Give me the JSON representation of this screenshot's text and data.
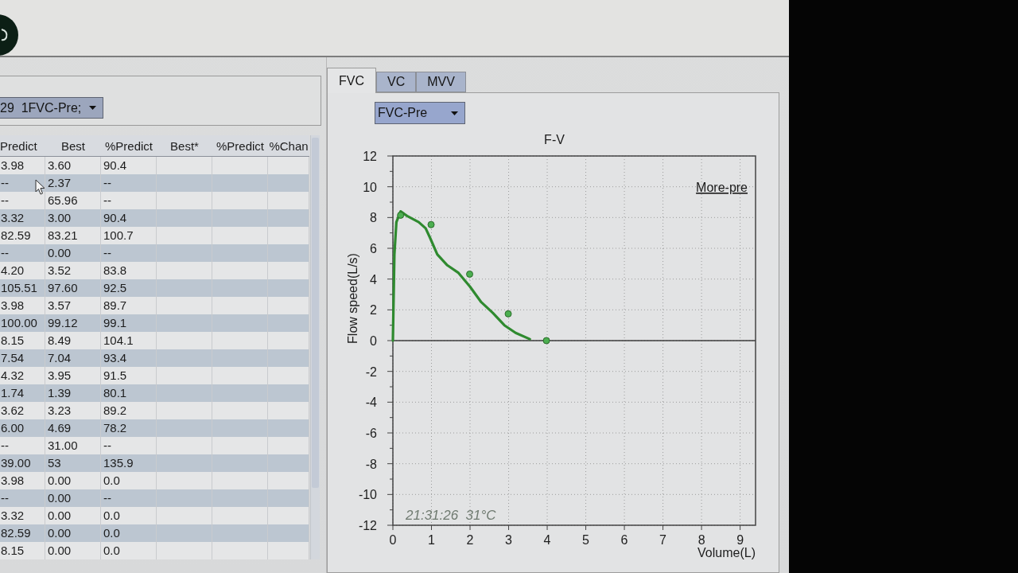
{
  "test_selector": {
    "value": "29  1FVC-Pre;"
  },
  "results_table": {
    "columns": [
      "Predict",
      "Best",
      "%Predict",
      "Best*",
      "%Predict",
      "%Chan"
    ],
    "rows": [
      [
        "3.98",
        "3.60",
        "90.4"
      ],
      [
        "--",
        "2.37",
        "--"
      ],
      [
        "--",
        "65.96",
        "--"
      ],
      [
        "3.32",
        "3.00",
        "90.4"
      ],
      [
        "82.59",
        "83.21",
        "100.7"
      ],
      [
        "--",
        "0.00",
        "--"
      ],
      [
        "4.20",
        "3.52",
        "83.8"
      ],
      [
        "105.51",
        "97.60",
        "92.5"
      ],
      [
        "3.98",
        "3.57",
        "89.7"
      ],
      [
        "100.00",
        "99.12",
        "99.1"
      ],
      [
        "8.15",
        "8.49",
        "104.1"
      ],
      [
        "7.54",
        "7.04",
        "93.4"
      ],
      [
        "4.32",
        "3.95",
        "91.5"
      ],
      [
        "1.74",
        "1.39",
        "80.1"
      ],
      [
        "3.62",
        "3.23",
        "89.2"
      ],
      [
        "6.00",
        "4.69",
        "78.2"
      ],
      [
        "--",
        "31.00",
        "--"
      ],
      [
        "39.00",
        "53",
        "135.9"
      ],
      [
        "3.98",
        "0.00",
        "0.0"
      ],
      [
        "--",
        "0.00",
        "--"
      ],
      [
        "3.32",
        "0.00",
        "0.0"
      ],
      [
        "82.59",
        "0.00",
        "0.0"
      ],
      [
        "8.15",
        "0.00",
        "0.0"
      ]
    ]
  },
  "chart_panel": {
    "tabs": [
      {
        "label": "FVC",
        "selected": true
      },
      {
        "label": "VC",
        "selected": false
      },
      {
        "label": "MVV",
        "selected": false
      }
    ],
    "curve_selector": {
      "value": "FVC-Pre"
    },
    "chart_data": [
      {
        "type": "line",
        "title": "F-V",
        "xlabel": "Volume(L)",
        "ylabel": "Flow speed(L/s)",
        "xlim": [
          0,
          9.4
        ],
        "ylim": [
          -12,
          12
        ],
        "xticks": [
          0,
          1,
          2,
          3,
          4,
          5,
          6,
          7,
          8,
          9
        ],
        "yticks": [
          -12,
          -10,
          -8,
          -6,
          -4,
          -2,
          0,
          2,
          4,
          6,
          8,
          10,
          12
        ],
        "grid": true,
        "ref_lines": [
          {
            "axis": "y",
            "value": 0,
            "color": "#3c3c3c",
            "line_style": "solid"
          }
        ],
        "annotations": [
          "More-pre",
          "21:31:26  31°C"
        ],
        "series": [
          {
            "type": "line",
            "color": "#2f8a2f",
            "x": [
              0,
              0.04,
              0.09,
              0.2,
              0.37,
              0.67,
              0.85,
              0.96,
              1.15,
              1.41,
              1.7,
              2.0,
              2.29,
              2.59,
              2.89,
              3.18,
              3.55
            ],
            "values": [
              0,
              5.6,
              7.7,
              8.4,
              8.1,
              7.7,
              7.3,
              6.7,
              5.6,
              4.9,
              4.4,
              3.5,
              2.5,
              1.8,
              1.0,
              0.5,
              0.1
            ]
          },
          {
            "type": "scatter",
            "color": "#4caf50",
            "x": [
              0.2,
              0.99,
              1.99,
              2.99,
              3.98
            ],
            "values": [
              8.15,
              7.54,
              4.32,
              1.74,
              0
            ]
          }
        ]
      }
    ]
  }
}
